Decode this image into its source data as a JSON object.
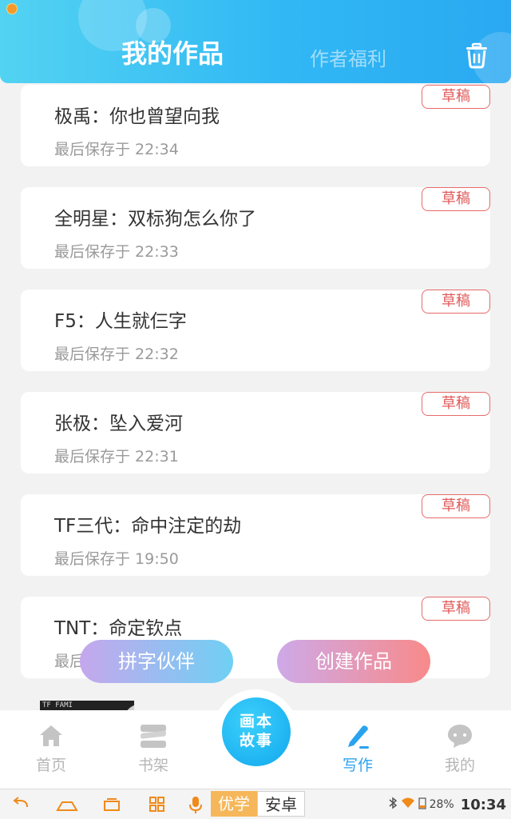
{
  "header": {
    "tab_active": "我的作品",
    "tab_inactive": "作者福利",
    "trash_icon": "trash-icon"
  },
  "works": [
    {
      "title": "极禹：你也曾望向我",
      "time": "最后保存于 22:34",
      "badge": "草稿"
    },
    {
      "title": "全明星：双标狗怎么你了",
      "time": "最后保存于 22:33",
      "badge": "草稿"
    },
    {
      "title": "F5：人生就仨字",
      "time": "最后保存于 22:32",
      "badge": "草稿"
    },
    {
      "title": "张极：坠入爱河",
      "time": "最后保存于 22:31",
      "badge": "草稿"
    },
    {
      "title": "TF三代：命中注定的劫",
      "time": "最后保存于 19:50",
      "badge": "草稿"
    },
    {
      "title": "TNT：命定钦点",
      "time": "最后保存于",
      "badge": "草稿"
    }
  ],
  "floating": {
    "partner_label": "拼字伙伴",
    "create_label": "创建作品"
  },
  "thumbnail_text": "TF FAMI",
  "bottom_nav": {
    "home": "首页",
    "shelf": "书架",
    "center_line1": "画本",
    "center_line2": "故事",
    "write": "写作",
    "mine": "我的"
  },
  "system_bar": {
    "ime_active": "优学",
    "ime_other": "安卓",
    "battery": "28%",
    "time": "10:34"
  },
  "colors": {
    "accent": "#2aa3ef",
    "draft_red": "#e05a5a",
    "header_start": "#53d3f2",
    "header_end": "#2aa9f2"
  }
}
